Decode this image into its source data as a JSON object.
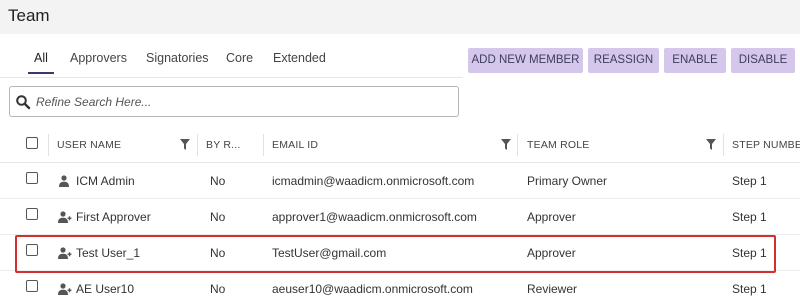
{
  "page": {
    "title": "Team"
  },
  "tabs": [
    {
      "label": "All",
      "active": true
    },
    {
      "label": "Approvers",
      "active": false
    },
    {
      "label": "Signatories",
      "active": false
    },
    {
      "label": "Core",
      "active": false
    },
    {
      "label": "Extended",
      "active": false
    }
  ],
  "toolbar": {
    "add_new_member": "ADD NEW MEMBER",
    "reassign": "REASSIGN",
    "enable": "ENABLE",
    "disable": "DISABLE"
  },
  "search": {
    "placeholder": "Refine Search Here..."
  },
  "table": {
    "columns": {
      "user_name": "USER NAME",
      "by_r": "BY R...",
      "email_id": "EMAIL ID",
      "team_role": "TEAM ROLE",
      "step_number": "STEP NUMBER"
    },
    "rows": [
      {
        "icon": "person-icon",
        "user_name": "ICM Admin",
        "by_r": "No",
        "email": "icmadmin@waadicm.onmicrosoft.com",
        "team_role": "Primary Owner",
        "step": "Step 1"
      },
      {
        "icon": "person-add-icon",
        "user_name": "First Approver",
        "by_r": "No",
        "email": "approver1@waadicm.onmicrosoft.com",
        "team_role": "Approver",
        "step": "Step 1"
      },
      {
        "icon": "person-add-icon",
        "user_name": "Test User_1",
        "by_r": "No",
        "email": "TestUser@gmail.com",
        "team_role": "Approver",
        "step": "Step 1"
      },
      {
        "icon": "person-add-icon",
        "user_name": "AE User10",
        "by_r": "No",
        "email": "aeuser10@waadicm.onmicrosoft.com",
        "team_role": "Reviewer",
        "step": "Step 1"
      }
    ]
  },
  "colors": {
    "button_bg": "#d5c6ec",
    "highlight_border": "#d32f2f",
    "header_bg": "#f3f3f3"
  }
}
